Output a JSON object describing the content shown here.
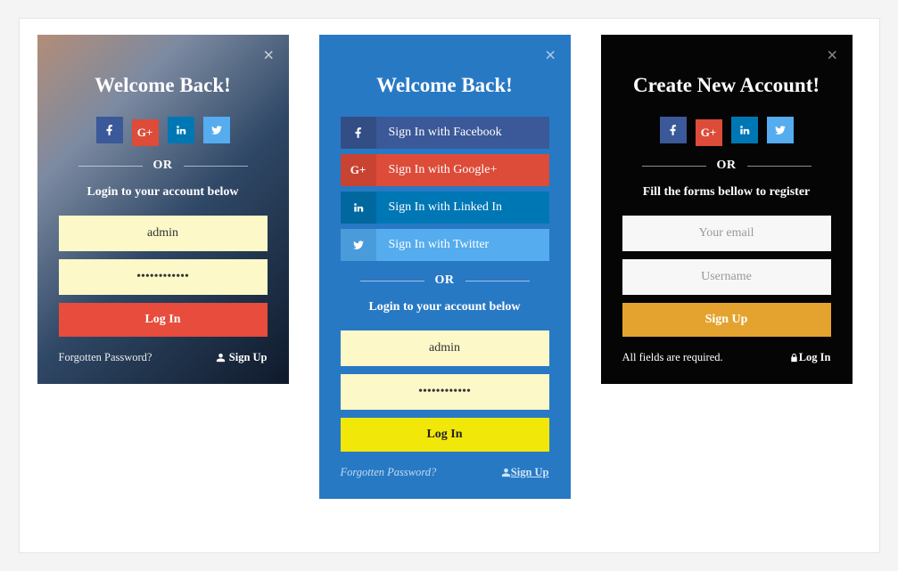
{
  "card1": {
    "close": "×",
    "title": "Welcome Back!",
    "sep": "OR",
    "subtitle": "Login to your account below",
    "username_value": "admin",
    "password_stub": "••••••••••••",
    "login_btn": "Log In",
    "forgot": "Forgotten Password?",
    "signup": "Sign Up",
    "signup_icon": "👤"
  },
  "card2": {
    "close": "×",
    "title": "Welcome Back!",
    "social": {
      "fb": "Sign In with Facebook",
      "gp": "Sign In with Google+",
      "li": "Sign In with Linked In",
      "tw": "Sign In with Twitter"
    },
    "sep": "OR",
    "subtitle": "Login to your account below",
    "username_value": "admin",
    "password_stub": "••••••••••••",
    "login_btn": "Log In",
    "forgot": "Forgotten Password?",
    "signup": "Sign Up"
  },
  "card3": {
    "close": "×",
    "title": "Create New Account!",
    "sep": "OR",
    "subtitle": "Fill the forms bellow to register",
    "email_placeholder": "Your email",
    "username_placeholder": "Username",
    "signup_btn": "Sign Up",
    "footer_left": "All fields are required.",
    "login": "Log In"
  },
  "icons": {
    "facebook": "facebook-icon",
    "googleplus": "googleplus-icon",
    "linkedin": "linkedin-icon",
    "twitter": "twitter-icon",
    "person": "person-icon",
    "lock": "lock-icon"
  },
  "colors": {
    "facebook": "#3b5998",
    "googleplus": "#dd4b39",
    "linkedin": "#0077b5",
    "twitter": "#55acee",
    "red_btn": "#e74c3c",
    "yellow_btn": "#f1e80a",
    "orange_btn": "#e4a32e",
    "card2_bg": "#2879c4"
  }
}
